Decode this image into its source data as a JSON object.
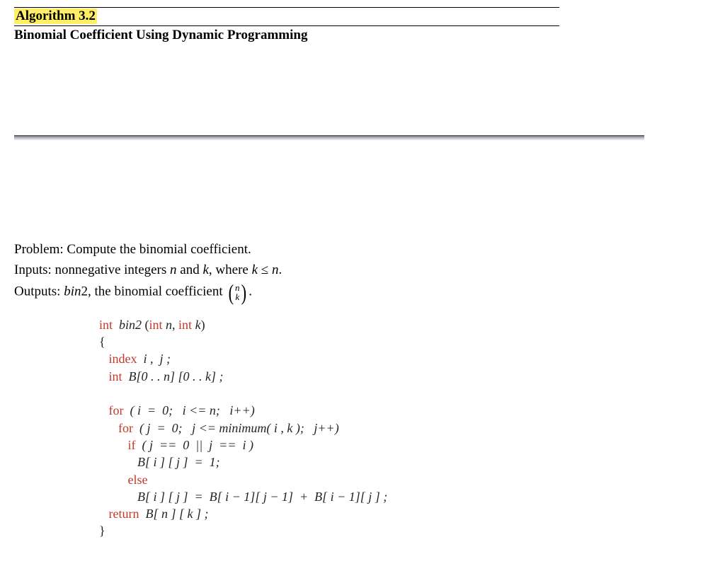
{
  "header": {
    "algorithm_label": "Algorithm 3.2",
    "title": "Binomial Coefficient Using Dynamic Programming"
  },
  "problem": {
    "label": "Problem: ",
    "text": "Compute the binomial coefficient."
  },
  "inputs": {
    "label": "Inputs: ",
    "pre": "nonnegative integers ",
    "var_n": "n",
    "mid": " and ",
    "var_k": "k",
    "post": ", where ",
    "cond_k": "k",
    "cond_rel": " ≤ ",
    "cond_n": "n",
    "end": "."
  },
  "outputs": {
    "label": "Outputs: ",
    "func": "bin",
    "funcnum": "2",
    "mid": ", the binomial coefficient ",
    "binom_top": "n",
    "binom_bot": "k",
    "end": "."
  },
  "code": {
    "l1_kw_int": "int",
    "l1_fn": "  bin2 ",
    "l1_p1": "(",
    "l1_kw_int2": "int",
    "l1_sp1": " n",
    "l1_c": ", ",
    "l1_kw_int3": "int",
    "l1_sp2": " k",
    "l1_p2": ")",
    "l2": "{",
    "l3_kw": "index",
    "l3_rest": "  i ,  j ;",
    "l4_kw": "int",
    "l4_rest": "  B[0 . . n] [0 . . k] ;",
    "l6_kw": "for",
    "l6_rest": "  ( i  =  0;   i <= n;   i++)",
    "l7_kw": "for",
    "l7_rest": "  ( j  =  0;   j <= minimum( i , k );   j++)",
    "l8_kw": "if",
    "l8_rest": "  ( j  ==  0  ||  j  ==  i )",
    "l9": "B[ i ] [ j ]  =  1;",
    "l10_kw": "else",
    "l11": "B[ i ] [ j ]  =  B[ i − 1][ j − 1]  +  B[ i − 1][ j ] ;",
    "l12_kw": "return",
    "l12_rest": "  B[ n ] [ k ] ;",
    "l13": "}"
  }
}
